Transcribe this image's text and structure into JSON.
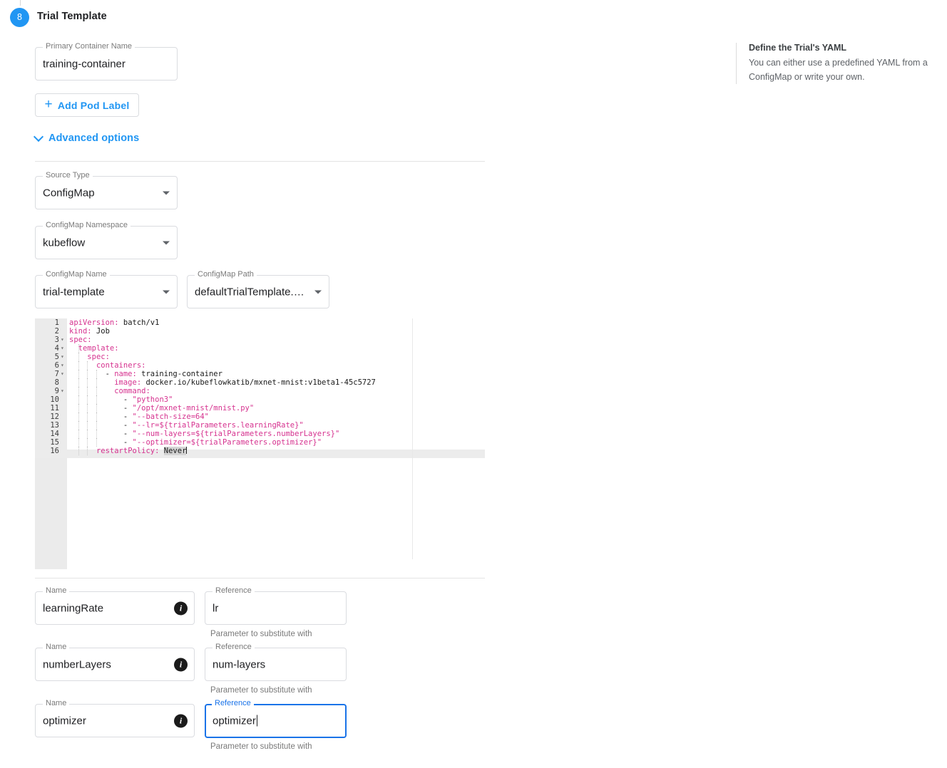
{
  "step": {
    "number": "8",
    "title": "Trial Template"
  },
  "primary_container": {
    "label": "Primary Container Name",
    "value": "training-container"
  },
  "add_pod_label_button": {
    "icon": "plus-icon",
    "label": "Add Pod Label"
  },
  "advanced_options": {
    "icon": "chevron-down-icon",
    "label": "Advanced options"
  },
  "source": {
    "source_type": {
      "label": "Source Type",
      "value": "ConfigMap"
    },
    "configmap_namespace": {
      "label": "ConfigMap Namespace",
      "value": "kubeflow"
    },
    "configmap_name": {
      "label": "ConfigMap Name",
      "value": "trial-template"
    },
    "configmap_path": {
      "label": "ConfigMap Path",
      "value": "defaultTrialTemplate.ya…"
    }
  },
  "editor": {
    "active_line": 16,
    "lines": [
      {
        "n": "1",
        "fold": false,
        "indent": 0,
        "text": "apiVersion: batch/v1"
      },
      {
        "n": "2",
        "fold": false,
        "indent": 0,
        "text": "kind: Job"
      },
      {
        "n": "3",
        "fold": true,
        "indent": 0,
        "text": "spec:"
      },
      {
        "n": "4",
        "fold": true,
        "indent": 1,
        "text": "  template:"
      },
      {
        "n": "5",
        "fold": true,
        "indent": 1,
        "text": "    spec:"
      },
      {
        "n": "6",
        "fold": true,
        "indent": 2,
        "text": "      containers:"
      },
      {
        "n": "7",
        "fold": true,
        "indent": 3,
        "text": "        - name: training-container"
      },
      {
        "n": "8",
        "fold": false,
        "indent": 3,
        "text": "          image: docker.io/kubeflowkatib/mxnet-mnist:v1beta1-45c5727"
      },
      {
        "n": "9",
        "fold": true,
        "indent": 3,
        "text": "          command:"
      },
      {
        "n": "10",
        "fold": false,
        "indent": 3,
        "text": "            - \"python3\""
      },
      {
        "n": "11",
        "fold": false,
        "indent": 3,
        "text": "            - \"/opt/mxnet-mnist/mnist.py\""
      },
      {
        "n": "12",
        "fold": false,
        "indent": 3,
        "text": "            - \"--batch-size=64\""
      },
      {
        "n": "13",
        "fold": false,
        "indent": 3,
        "text": "            - \"--lr=${trialParameters.learningRate}\""
      },
      {
        "n": "14",
        "fold": false,
        "indent": 3,
        "text": "            - \"--num-layers=${trialParameters.numberLayers}\""
      },
      {
        "n": "15",
        "fold": false,
        "indent": 3,
        "text": "            - \"--optimizer=${trialParameters.optimizer}\""
      },
      {
        "n": "16",
        "fold": false,
        "indent": 2,
        "text": "      restartPolicy: Never"
      }
    ]
  },
  "parameters": {
    "name_label": "Name",
    "reference_label": "Reference",
    "reference_hint": "Parameter to substitute with",
    "rows": [
      {
        "name": "learningRate",
        "reference": "lr",
        "focused": false
      },
      {
        "name": "numberLayers",
        "reference": "num-layers",
        "focused": false
      },
      {
        "name": "optimizer",
        "reference": "optimizer",
        "focused": true
      }
    ]
  },
  "help": {
    "title": "Define the Trial's YAML",
    "body": "You can either use a predefined YAML from a ConfigMap or write your own."
  },
  "colors": {
    "accent": "#2196f3",
    "focus": "#1a73e8",
    "yaml_key": "#d6328f",
    "gutter": "#ebebeb"
  }
}
